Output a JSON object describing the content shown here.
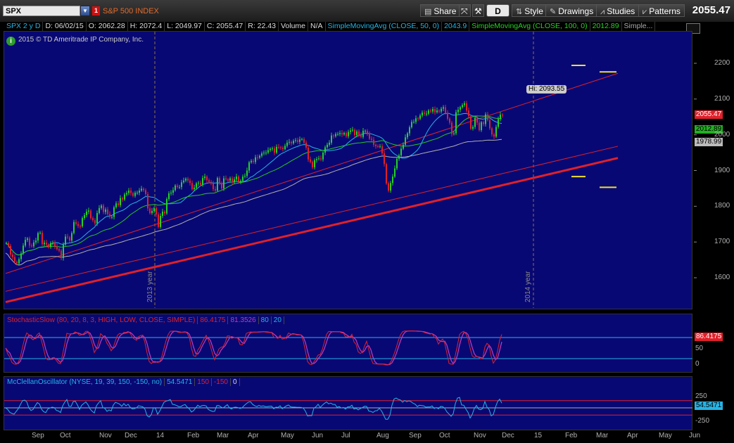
{
  "toolbar": {
    "symbol": "SPX",
    "link_badge": "1",
    "description": "S&P 500 INDEX",
    "share_label": "Share",
    "aggregation_label": "D",
    "style_label": "Style",
    "drawings_label": "Drawings",
    "studies_label": "Studies",
    "patterns_label": "Patterns",
    "last_price": "2055.47"
  },
  "info": {
    "period": "SPX 2 y D",
    "date": "D: 06/02/15",
    "open": "O: 2062.28",
    "high": "H: 2072.4",
    "low": "L: 2049.97",
    "close": "C: 2055.47",
    "range": "R: 22.43",
    "volume_label": "Volume",
    "volume_value": "N/A",
    "sma50_label": "SimpleMovingAvg (CLOSE, 50, 0)",
    "sma50_value": "2043.9",
    "sma100_label": "SimpleMovingAvg (CLOSE, 100, 0)",
    "sma100_value": "2012.89",
    "more_label": "Simple..."
  },
  "copyright": "2015 © TD Ameritrade IP Company, Inc.",
  "hi_label": "Hi: 2093.55",
  "year_markers": [
    "2013 year",
    "2014 year"
  ],
  "price_labels": {
    "last": "2055.47",
    "sma100": "2012.89",
    "sma200": "1978.99"
  },
  "stoch": {
    "title": "StochasticSlow (80, 20, 8, 3, HIGH, LOW, CLOSE, SIMPLE)",
    "k_value": "86.4175",
    "d_value": "81.3526",
    "over_bought": "80",
    "over_sold": "20",
    "axis_label": "86.4175",
    "tick_50": "50",
    "tick_0": "0"
  },
  "mcc": {
    "title": "McClellanOscillator (NYSE, 19, 39, 150, -150, no)",
    "value": "54.5471",
    "upper": "150",
    "lower": "-150",
    "zero": "0",
    "axis_label": "54.5471",
    "tick_top": "250",
    "tick_bottom": "-250"
  },
  "colors": {
    "panel_bg": "#080874",
    "bull": "#25d225",
    "bear": "#e0202a",
    "sma50": "#25b4e6",
    "sma100": "#22c822",
    "sma200": "#b0b0b0",
    "channel": "#e0202a",
    "yellow": "#f0e030"
  },
  "icons": [
    "share-icon",
    "link-icon",
    "wrench-icon",
    "style-icon",
    "pencil-icon",
    "studies-icon",
    "patterns-icon"
  ],
  "chart_data": {
    "type": "candlestick",
    "title": "S&P 500 INDEX",
    "symbol": "SPX",
    "aggregation": "2 year daily",
    "ylim": [
      1530,
      2270
    ],
    "y_ticks": [
      1600,
      1700,
      1800,
      1900,
      2000,
      2100,
      2200
    ],
    "x_labels": [
      "Sep",
      "Oct",
      "Nov",
      "Dec",
      "14",
      "Feb",
      "Mar",
      "Apr",
      "May",
      "Jun",
      "Jul",
      "Aug",
      "Sep",
      "Oct",
      "Nov",
      "Dec",
      "15",
      "Feb",
      "Mar",
      "Apr",
      "May",
      "Jun"
    ],
    "series": [
      {
        "name": "SPX",
        "t": [
          0,
          3,
          6,
          9,
          12,
          15,
          18,
          21,
          24,
          27,
          30,
          33,
          36,
          39,
          42,
          45,
          48,
          51,
          54,
          57,
          60,
          63,
          66,
          69,
          72,
          75,
          78,
          81,
          84,
          87,
          90,
          93,
          96,
          99,
          102,
          105,
          108,
          111,
          114,
          117,
          120,
          123,
          126,
          129,
          132,
          135,
          138,
          141,
          144,
          147,
          150,
          153,
          156,
          159,
          162,
          165,
          168,
          171,
          174,
          177,
          180,
          183,
          186,
          189,
          192,
          195,
          198,
          201,
          204,
          207,
          210,
          213,
          216,
          219,
          222,
          225,
          228,
          231,
          234,
          237,
          240,
          243,
          246,
          249,
          252,
          255,
          258,
          261,
          264,
          267,
          270,
          273,
          276,
          279,
          282,
          285,
          288,
          291,
          294,
          297,
          300,
          303,
          306,
          309,
          312,
          315,
          318,
          321,
          324,
          327,
          330,
          333,
          336,
          339,
          342,
          345,
          348,
          351,
          354,
          357,
          360,
          363,
          366,
          369,
          372,
          375,
          378,
          381,
          384,
          387,
          390,
          393,
          396,
          399,
          402,
          405,
          408,
          411,
          414,
          417,
          420,
          423,
          426,
          429,
          432,
          435,
          438,
          441,
          444,
          447,
          450,
          453,
          456,
          459,
          462,
          465,
          468,
          471,
          474,
          477,
          480,
          483,
          486,
          489,
          492,
          495,
          498,
          501,
          504,
          507,
          510,
          513,
          516,
          519,
          522,
          525,
          528,
          531,
          534,
          537,
          540,
          543,
          546,
          549,
          552,
          555,
          558,
          561,
          564,
          567,
          570,
          573,
          576,
          579,
          582,
          585,
          588,
          591,
          594,
          597,
          600,
          603,
          606,
          609,
          612,
          615,
          618,
          621,
          624,
          627,
          630,
          633,
          636,
          639,
          642,
          645,
          648,
          651,
          654,
          657,
          660,
          663,
          666,
          669,
          672,
          675,
          678,
          681,
          684,
          687,
          690,
          693,
          696,
          699,
          702,
          705,
          708,
          711,
          714,
          717,
          720,
          723,
          726,
          729,
          732,
          735,
          738,
          741,
          744,
          747,
          750,
          753,
          756,
          759,
          762,
          765,
          768,
          771,
          774,
          777,
          780,
          783,
          786,
          789,
          792,
          795,
          798,
          801,
          804,
          807,
          810
        ],
        "close": [
          1697,
          1689,
          1665,
          1658,
          1645,
          1640,
          1652,
          1668,
          1690,
          1706,
          1710,
          1690,
          1688,
          1699,
          1704,
          1725,
          1726,
          1694,
          1698,
          1693,
          1686,
          1697,
          1698,
          1688,
          1680,
          1676,
          1655,
          1693,
          1715,
          1713,
          1704,
          1725,
          1756,
          1750,
          1745,
          1744,
          1767,
          1775,
          1785,
          1788,
          1767,
          1761,
          1752,
          1781,
          1795,
          1802,
          1784,
          1791,
          1778,
          1770,
          1770,
          1797,
          1808,
          1803,
          1823,
          1819,
          1833,
          1837,
          1844,
          1837,
          1829,
          1838,
          1838,
          1844,
          1849,
          1845,
          1834,
          1794,
          1781,
          1787,
          1795,
          1777,
          1742,
          1773,
          1785,
          1780,
          1820,
          1836,
          1838,
          1845,
          1858,
          1854,
          1854,
          1867,
          1872,
          1877,
          1872,
          1865,
          1848,
          1852,
          1864,
          1866,
          1860,
          1879,
          1883,
          1873,
          1868,
          1864,
          1848,
          1844,
          1879,
          1864,
          1850,
          1878,
          1875,
          1872,
          1878,
          1867,
          1875,
          1883,
          1869,
          1871,
          1883,
          1885,
          1900,
          1923,
          1927,
          1924,
          1937,
          1936,
          1941,
          1948,
          1950,
          1950,
          1957,
          1961,
          1962,
          1950,
          1966,
          1965,
          1964,
          1960,
          1969,
          1978,
          1980,
          1976,
          1983,
          1985,
          1980,
          1987,
          1988,
          1978,
          1964,
          1931,
          1924,
          1909,
          1929,
          1932,
          1934,
          1931,
          1950,
          1965,
          1972,
          1978,
          1998,
          1996,
          2002,
          2002,
          2005,
          2001,
          2005,
          1996,
          2008,
          2012,
          2014,
          1999,
          2009,
          2000,
          1994,
          2011,
          2011,
          2004,
          1989,
          1986,
          1972,
          1968,
          1967,
          1968,
          1948,
          1918,
          1864,
          1844,
          1865,
          1883,
          1906,
          1933,
          1942,
          1961,
          1972,
          1993,
          2004,
          2021,
          2036,
          2036,
          2046,
          2045,
          2054,
          2062,
          2059,
          2059,
          2068,
          2065,
          2072,
          2063,
          2068,
          2065,
          2073,
          2077,
          2061,
          2045,
          2034,
          2002,
          2004,
          2063,
          2070,
          2077,
          2083,
          2088,
          2068,
          2052,
          2017,
          2022,
          2048,
          2034,
          2013,
          2035,
          2030,
          2057,
          2041,
          2018,
          2001,
          1995,
          2022,
          2044,
          2056,
          2055
        ]
      },
      {
        "name": "SimpleMovingAvg (CLOSE, 50, 0)",
        "last": 2043.9
      },
      {
        "name": "SimpleMovingAvg (CLOSE, 100, 0)",
        "last": 2012.89
      },
      {
        "name": "",
        "last": 1978.99
      }
    ],
    "high_marker": {
      "label": "Hi: 2093.55",
      "value": 2093.55
    },
    "channel_lines": [
      {
        "from": [
          0,
          1612
        ],
        "to": [
          870,
          2172
        ]
      },
      {
        "from": [
          0,
          1562
        ],
        "to": [
          870,
          1968
        ]
      },
      {
        "from": [
          0,
          1532
        ],
        "to": [
          870,
          1935
        ]
      }
    ],
    "stochastic_slow": {
      "k": 86.4175,
      "d": 81.3526,
      "over_bought": 80,
      "over_sold": 20
    },
    "mcclellan": {
      "value": 54.5471,
      "upper": 150,
      "lower": -150
    }
  }
}
